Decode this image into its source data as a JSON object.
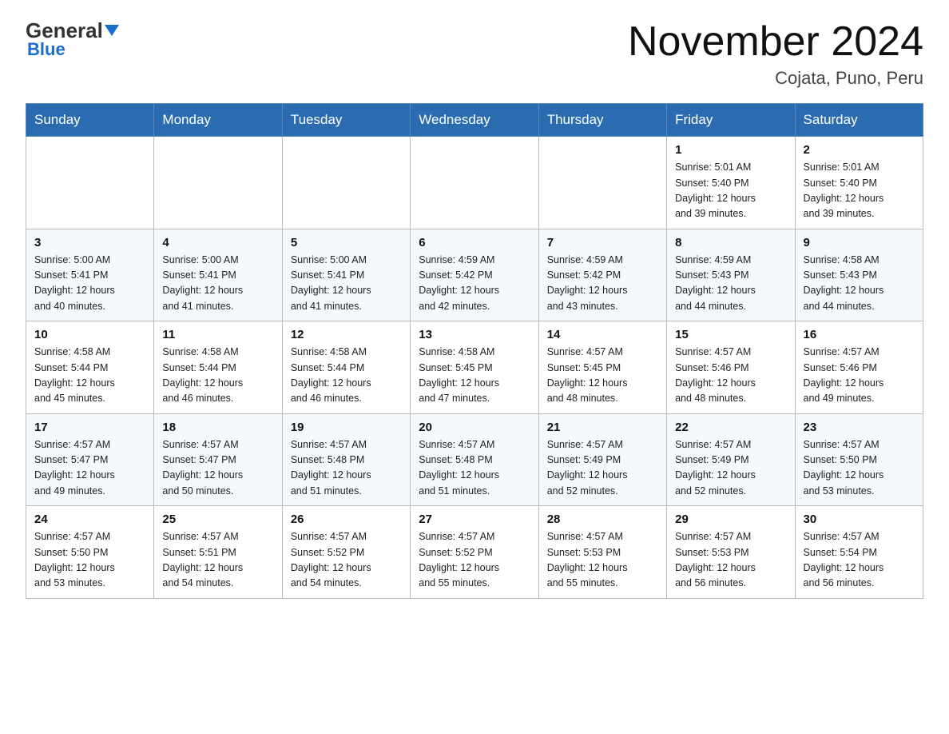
{
  "logo": {
    "general": "General",
    "blue": "Blue"
  },
  "header": {
    "title": "November 2024",
    "subtitle": "Cojata, Puno, Peru"
  },
  "weekdays": [
    "Sunday",
    "Monday",
    "Tuesday",
    "Wednesday",
    "Thursday",
    "Friday",
    "Saturday"
  ],
  "weeks": [
    [
      {
        "day": "",
        "info": ""
      },
      {
        "day": "",
        "info": ""
      },
      {
        "day": "",
        "info": ""
      },
      {
        "day": "",
        "info": ""
      },
      {
        "day": "",
        "info": ""
      },
      {
        "day": "1",
        "info": "Sunrise: 5:01 AM\nSunset: 5:40 PM\nDaylight: 12 hours\nand 39 minutes."
      },
      {
        "day": "2",
        "info": "Sunrise: 5:01 AM\nSunset: 5:40 PM\nDaylight: 12 hours\nand 39 minutes."
      }
    ],
    [
      {
        "day": "3",
        "info": "Sunrise: 5:00 AM\nSunset: 5:41 PM\nDaylight: 12 hours\nand 40 minutes."
      },
      {
        "day": "4",
        "info": "Sunrise: 5:00 AM\nSunset: 5:41 PM\nDaylight: 12 hours\nand 41 minutes."
      },
      {
        "day": "5",
        "info": "Sunrise: 5:00 AM\nSunset: 5:41 PM\nDaylight: 12 hours\nand 41 minutes."
      },
      {
        "day": "6",
        "info": "Sunrise: 4:59 AM\nSunset: 5:42 PM\nDaylight: 12 hours\nand 42 minutes."
      },
      {
        "day": "7",
        "info": "Sunrise: 4:59 AM\nSunset: 5:42 PM\nDaylight: 12 hours\nand 43 minutes."
      },
      {
        "day": "8",
        "info": "Sunrise: 4:59 AM\nSunset: 5:43 PM\nDaylight: 12 hours\nand 44 minutes."
      },
      {
        "day": "9",
        "info": "Sunrise: 4:58 AM\nSunset: 5:43 PM\nDaylight: 12 hours\nand 44 minutes."
      }
    ],
    [
      {
        "day": "10",
        "info": "Sunrise: 4:58 AM\nSunset: 5:44 PM\nDaylight: 12 hours\nand 45 minutes."
      },
      {
        "day": "11",
        "info": "Sunrise: 4:58 AM\nSunset: 5:44 PM\nDaylight: 12 hours\nand 46 minutes."
      },
      {
        "day": "12",
        "info": "Sunrise: 4:58 AM\nSunset: 5:44 PM\nDaylight: 12 hours\nand 46 minutes."
      },
      {
        "day": "13",
        "info": "Sunrise: 4:58 AM\nSunset: 5:45 PM\nDaylight: 12 hours\nand 47 minutes."
      },
      {
        "day": "14",
        "info": "Sunrise: 4:57 AM\nSunset: 5:45 PM\nDaylight: 12 hours\nand 48 minutes."
      },
      {
        "day": "15",
        "info": "Sunrise: 4:57 AM\nSunset: 5:46 PM\nDaylight: 12 hours\nand 48 minutes."
      },
      {
        "day": "16",
        "info": "Sunrise: 4:57 AM\nSunset: 5:46 PM\nDaylight: 12 hours\nand 49 minutes."
      }
    ],
    [
      {
        "day": "17",
        "info": "Sunrise: 4:57 AM\nSunset: 5:47 PM\nDaylight: 12 hours\nand 49 minutes."
      },
      {
        "day": "18",
        "info": "Sunrise: 4:57 AM\nSunset: 5:47 PM\nDaylight: 12 hours\nand 50 minutes."
      },
      {
        "day": "19",
        "info": "Sunrise: 4:57 AM\nSunset: 5:48 PM\nDaylight: 12 hours\nand 51 minutes."
      },
      {
        "day": "20",
        "info": "Sunrise: 4:57 AM\nSunset: 5:48 PM\nDaylight: 12 hours\nand 51 minutes."
      },
      {
        "day": "21",
        "info": "Sunrise: 4:57 AM\nSunset: 5:49 PM\nDaylight: 12 hours\nand 52 minutes."
      },
      {
        "day": "22",
        "info": "Sunrise: 4:57 AM\nSunset: 5:49 PM\nDaylight: 12 hours\nand 52 minutes."
      },
      {
        "day": "23",
        "info": "Sunrise: 4:57 AM\nSunset: 5:50 PM\nDaylight: 12 hours\nand 53 minutes."
      }
    ],
    [
      {
        "day": "24",
        "info": "Sunrise: 4:57 AM\nSunset: 5:50 PM\nDaylight: 12 hours\nand 53 minutes."
      },
      {
        "day": "25",
        "info": "Sunrise: 4:57 AM\nSunset: 5:51 PM\nDaylight: 12 hours\nand 54 minutes."
      },
      {
        "day": "26",
        "info": "Sunrise: 4:57 AM\nSunset: 5:52 PM\nDaylight: 12 hours\nand 54 minutes."
      },
      {
        "day": "27",
        "info": "Sunrise: 4:57 AM\nSunset: 5:52 PM\nDaylight: 12 hours\nand 55 minutes."
      },
      {
        "day": "28",
        "info": "Sunrise: 4:57 AM\nSunset: 5:53 PM\nDaylight: 12 hours\nand 55 minutes."
      },
      {
        "day": "29",
        "info": "Sunrise: 4:57 AM\nSunset: 5:53 PM\nDaylight: 12 hours\nand 56 minutes."
      },
      {
        "day": "30",
        "info": "Sunrise: 4:57 AM\nSunset: 5:54 PM\nDaylight: 12 hours\nand 56 minutes."
      }
    ]
  ]
}
